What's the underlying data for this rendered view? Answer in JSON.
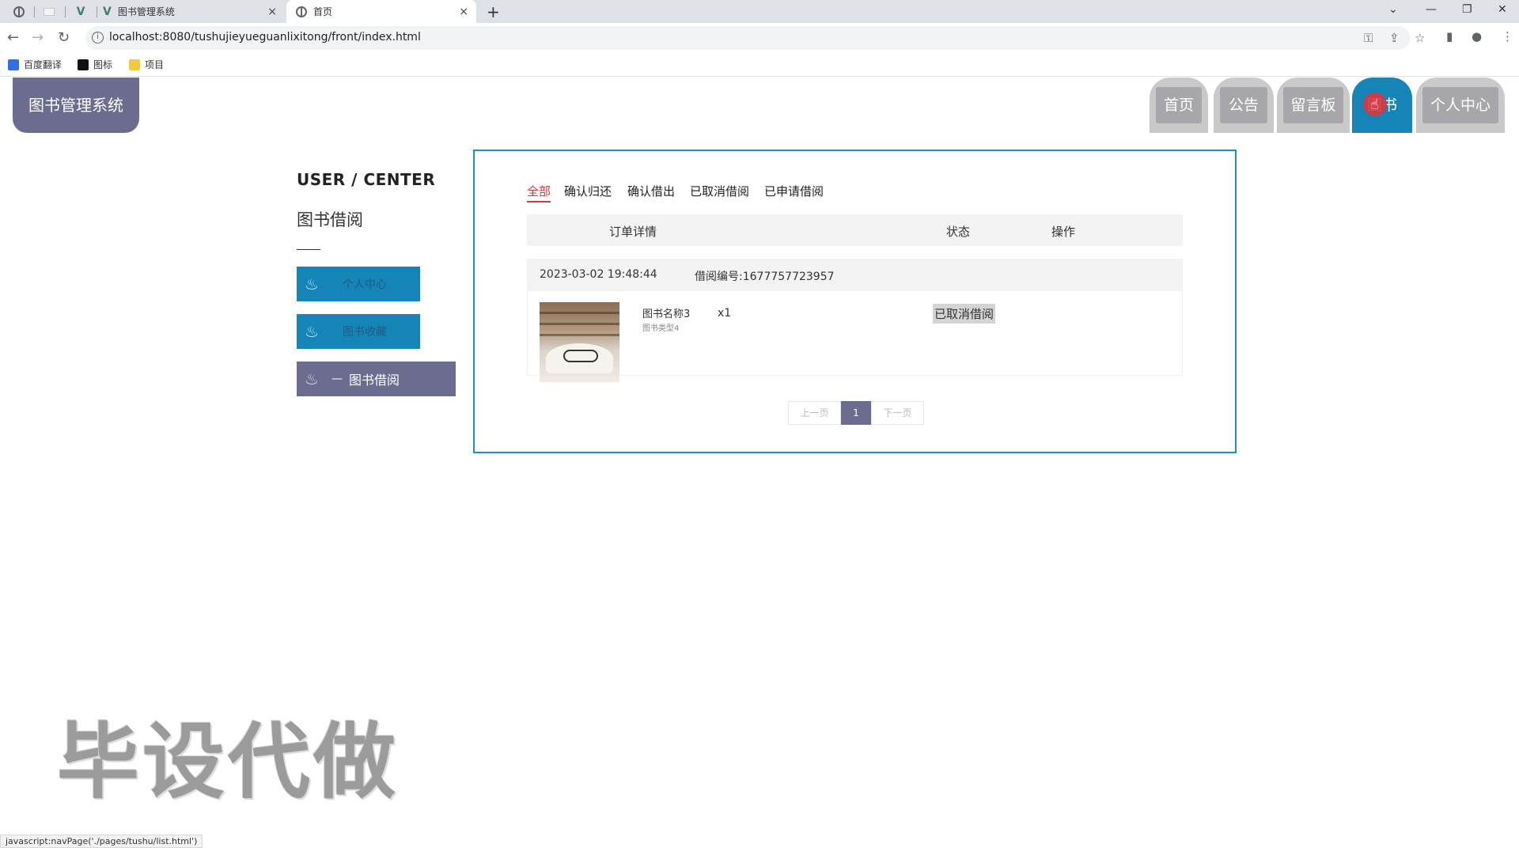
{
  "browser": {
    "tabs": [
      {
        "title": "",
        "icon": "globe-icon"
      },
      {
        "title": "",
        "icon": "blank-page-icon"
      },
      {
        "title": "",
        "icon": "vue-icon"
      },
      {
        "title": "图书管理系统",
        "icon": "vue-icon"
      },
      {
        "title": "首页",
        "icon": "globe-icon"
      }
    ],
    "tab_close": "×",
    "new_tab": "+",
    "url": "localhost:8080/tushujieyueguanlixitong/front/index.html",
    "bookmarks": [
      {
        "label": "百度翻译",
        "color": "#2e6ee6"
      },
      {
        "label": "图标",
        "color": "#111111"
      },
      {
        "label": "项目",
        "color": "#f3c83a"
      }
    ],
    "window_controls": [
      "⌄",
      "—",
      "❐",
      "✕"
    ],
    "status_text": "javascript:navPage('./pages/tushu/list.html')"
  },
  "header": {
    "brand": "图书管理系统",
    "nav": [
      {
        "label": "首页",
        "active": false
      },
      {
        "label": "公告",
        "active": false
      },
      {
        "label": "留言板",
        "active": false
      },
      {
        "label": "图书",
        "active": true
      },
      {
        "label": "个人中心",
        "active": false
      }
    ],
    "active_color": "#1585b8",
    "inactive_color": "#a7a7ab"
  },
  "sidebar": {
    "title": "USER / CENTER",
    "subtitle": "图书借阅",
    "items": [
      {
        "label": "个人中心",
        "active": false
      },
      {
        "label": "图书收藏",
        "active": false
      },
      {
        "label": "图书借阅",
        "active": true
      }
    ],
    "accent_color": "#6b6c8f"
  },
  "main": {
    "filter_tabs": [
      {
        "label": "全部",
        "active": true
      },
      {
        "label": "确认归还",
        "active": false
      },
      {
        "label": "确认借出",
        "active": false
      },
      {
        "label": "已取消借阅",
        "active": false
      },
      {
        "label": "已申请借阅",
        "active": false
      }
    ],
    "columns": [
      "订单详情",
      "状态",
      "操作"
    ],
    "orders": [
      {
        "time": "2023-03-02 19:48:44",
        "number_label": "借阅编号:1677757723957",
        "book_name": "图书名称3",
        "book_type": "图书类型4",
        "quantity": "x1",
        "status": "已取消借阅"
      }
    ],
    "pagination": {
      "prev": "上一页",
      "current": "1",
      "next": "下一页"
    }
  },
  "watermark": "毕设代做"
}
